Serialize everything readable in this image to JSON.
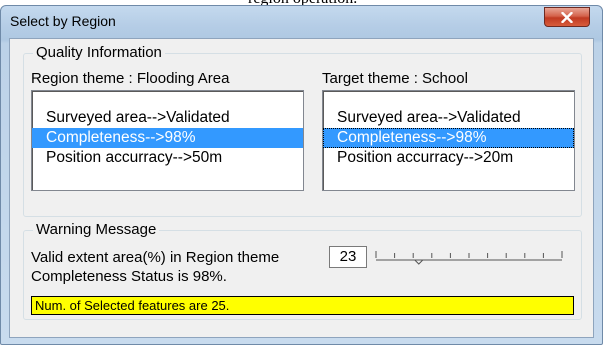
{
  "caption_fragment": "region operation.",
  "window": {
    "title": "Select by Region",
    "close_glyph": "×"
  },
  "quality": {
    "legend": "Quality Information",
    "region_label": "Region theme : Flooding Area",
    "target_label": "Target theme : School",
    "region_items": [
      "Surveyed area-->Validated",
      "Completeness-->98%",
      "Position accurracy-->50m"
    ],
    "target_items": [
      "Surveyed area-->Validated",
      "Completeness-->98%",
      "Position accurracy-->20m"
    ],
    "selected_index": 1
  },
  "warning": {
    "legend": "Warning Message",
    "extent_label": "Valid extent area(%) in Region theme",
    "extent_value": "23",
    "slider_fraction": 0.23,
    "status_line": "Completeness Status is 98%.",
    "selected_count_msg": "Num. of Selected features are 25."
  },
  "colors": {
    "selection": "#3399ff",
    "highlight": "#ffff00",
    "close_button": "#c8452c"
  }
}
